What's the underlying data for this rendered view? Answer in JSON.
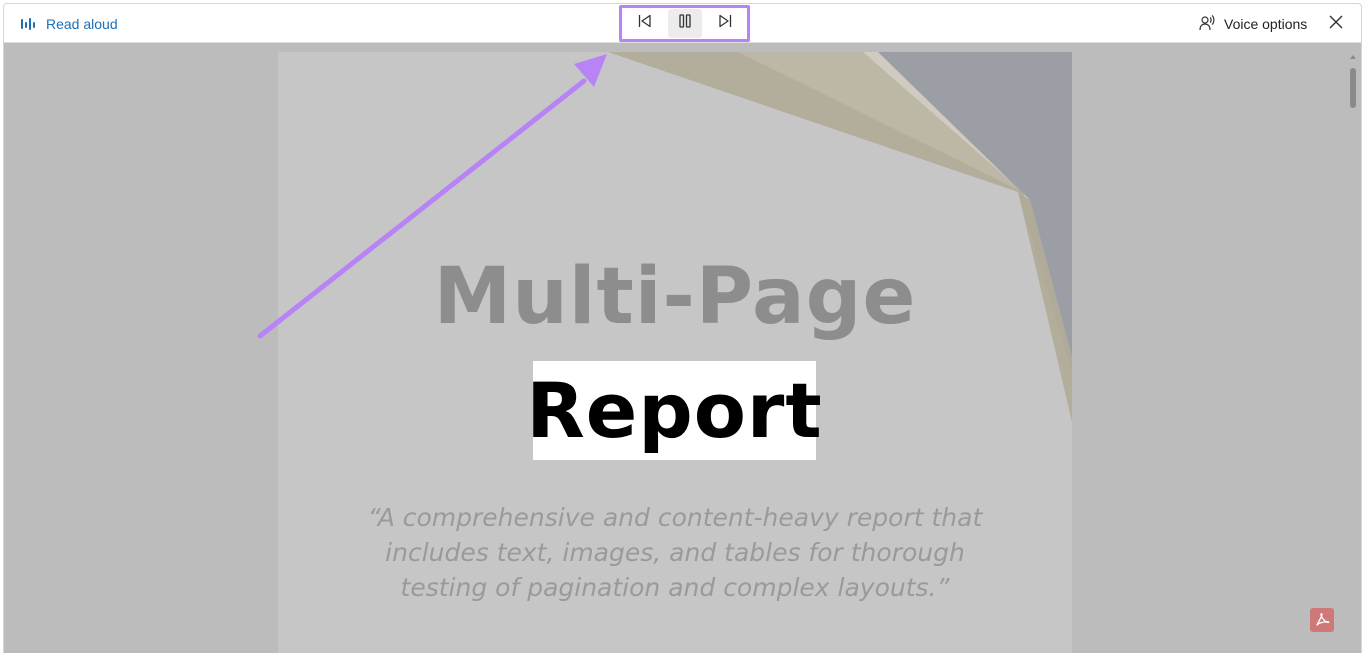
{
  "toolbar": {
    "read_aloud_label": "Read aloud",
    "voice_options_label": "Voice options",
    "controls": {
      "previous": "previous-icon",
      "pause": "pause-icon",
      "next": "next-icon"
    }
  },
  "document": {
    "title_line1": "Multi-Page",
    "title_line2": "Report",
    "quote": "“A comprehensive and content-heavy report that includes text, images, and tables for thorough testing of pagination and complex layouts.”"
  },
  "colors": {
    "accent": "#1a6fb5",
    "highlight_border": "#b884f5",
    "arrow": "#b884f5",
    "pdf_badge": "#cf7878"
  }
}
